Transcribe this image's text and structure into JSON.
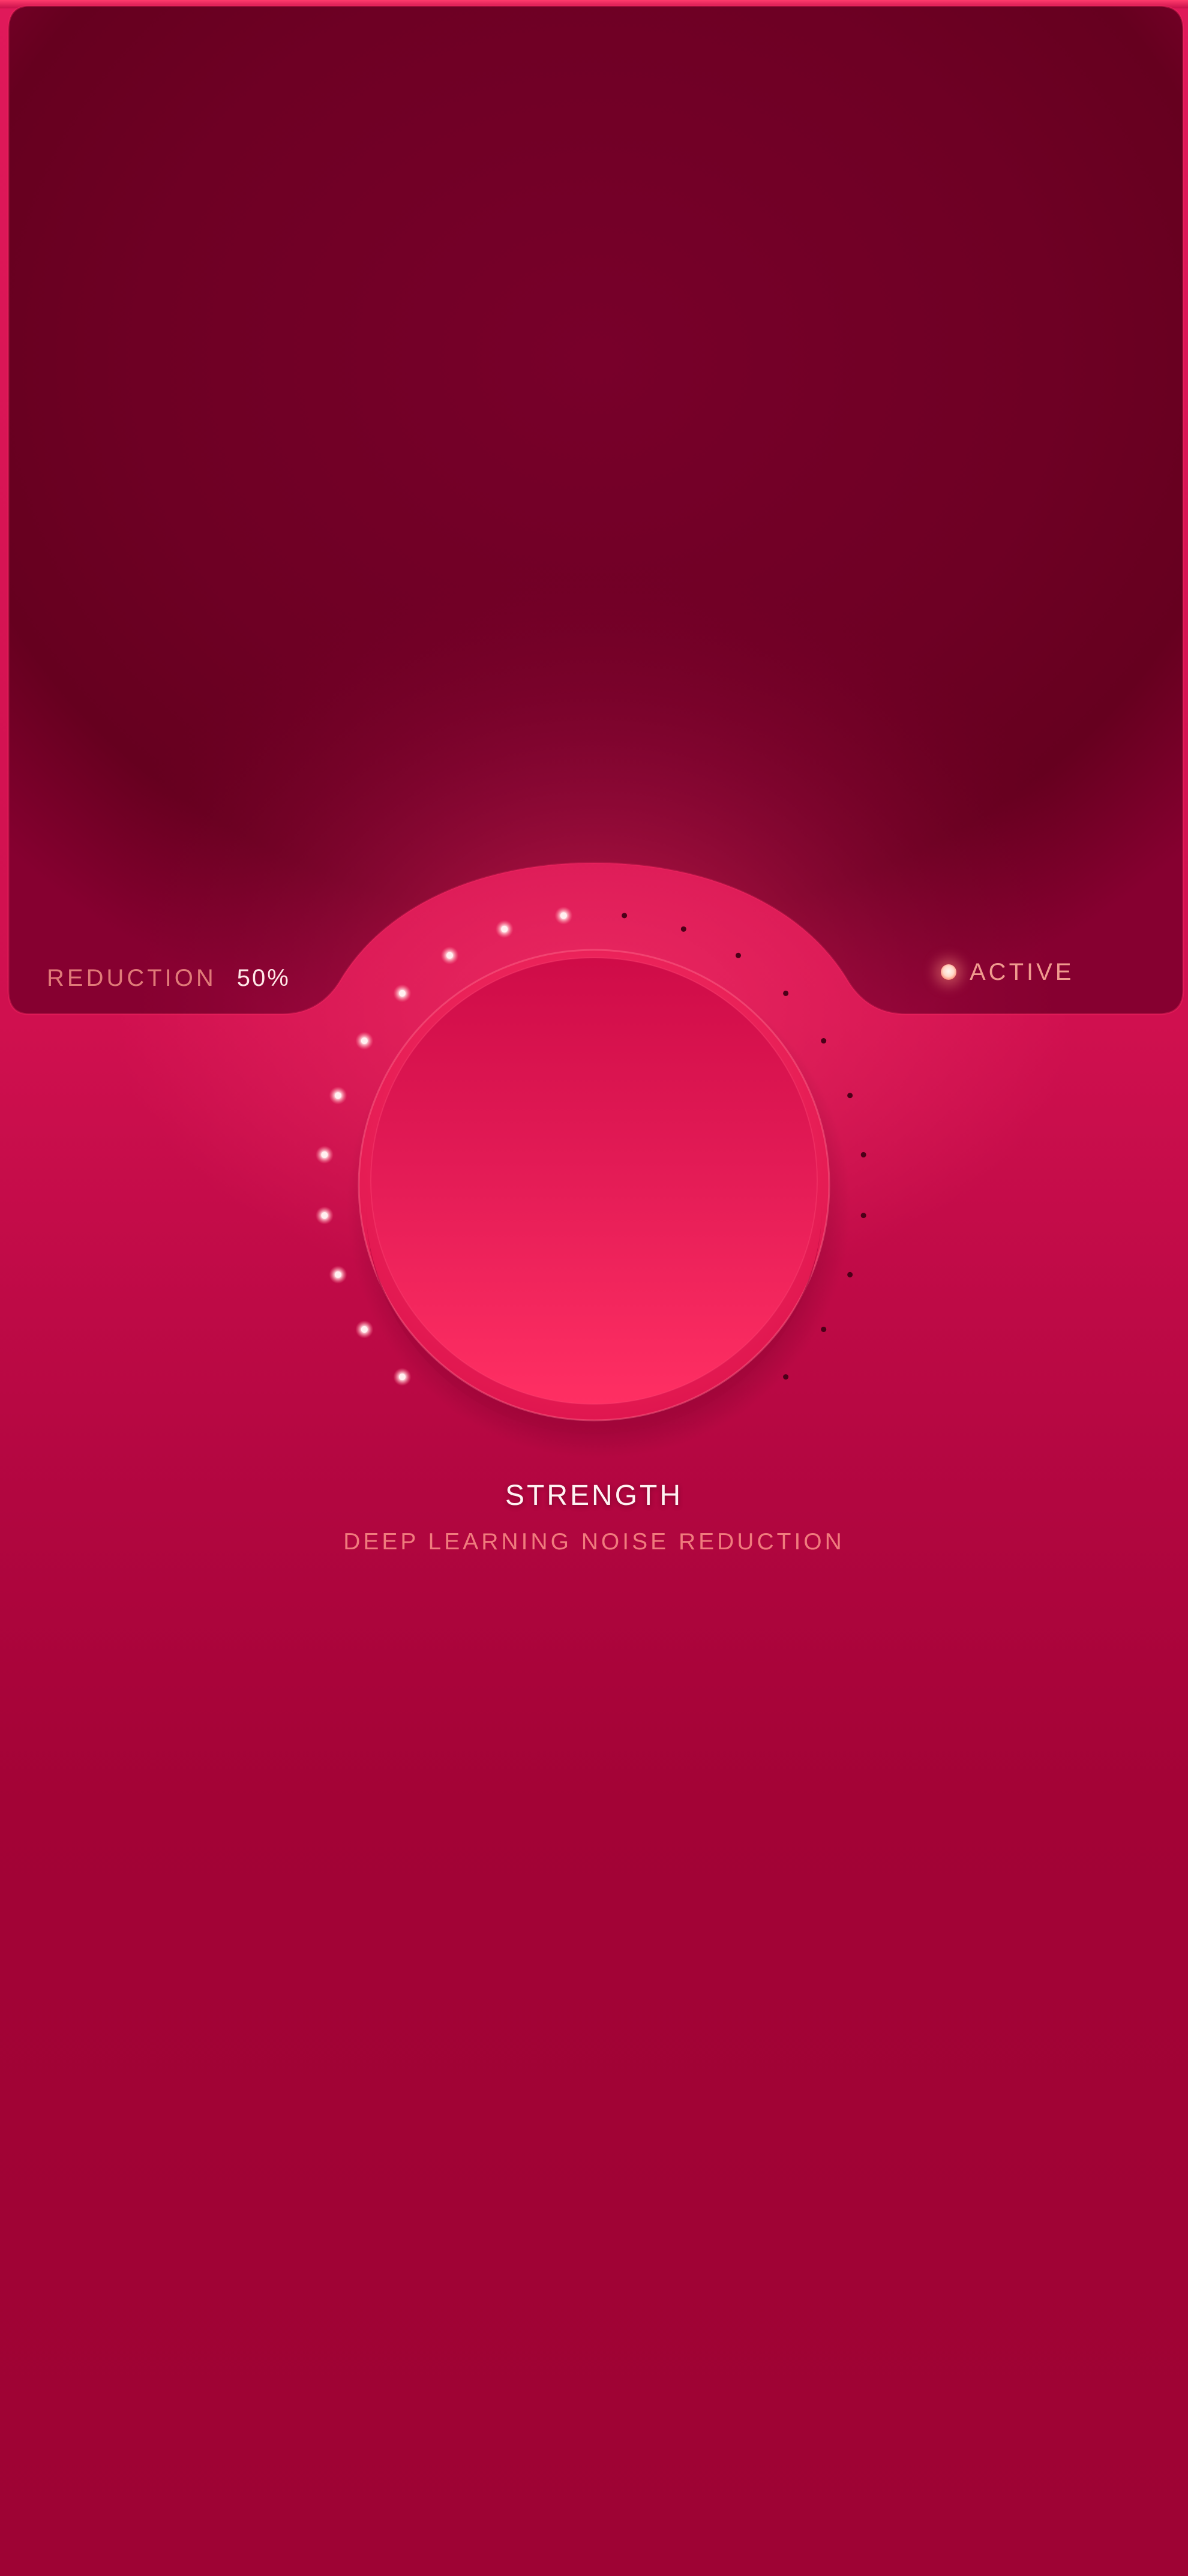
{
  "readout": {
    "reduction_label": "REDUCTION",
    "reduction_value": "50%",
    "status_label": "ACTIVE"
  },
  "knob": {
    "title": "STRENGTH",
    "subtitle": "DEEP LEARNING NOISE REDUCTION",
    "value_fraction": 0.5,
    "tick_count": 22,
    "lit_ticks": 11
  },
  "colors": {
    "background": "#d0104f",
    "panel": "#7a0029",
    "knob": "#ff2e63",
    "indicator": "#ffe6ea",
    "tick_lit": "#fff0f0",
    "tick_unlit": "#4b0018"
  },
  "icons": {
    "status_led": "status-led-icon",
    "knob_indicator": "knob-indicator-icon"
  }
}
